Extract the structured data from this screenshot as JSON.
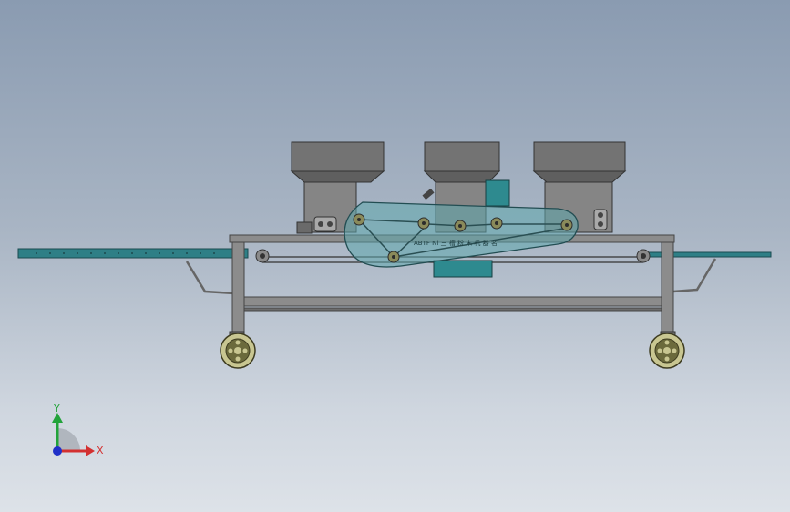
{
  "viewport": {
    "background_top": "#8a9bb1",
    "background_bottom": "#dde2e8"
  },
  "model": {
    "machine_label": "ABTF Ni 三 槽 粉 末 机 器 名",
    "colors": {
      "frame": "#8c8c8c",
      "frame_dark": "#555555",
      "hopper": "#6e6e6e",
      "hopper_light": "#8f8f8f",
      "conveyor": "#2e7f86",
      "guard_fill": "#5fa7ad",
      "motor": "#2e8a8f",
      "wheel_rim": "#6b6a3c",
      "wheel_tread": "#c8c691"
    }
  },
  "triad": {
    "x_label": "X",
    "y_label": "Y",
    "x_color": "#d33030",
    "y_color": "#22a33a",
    "z_color": "#2030c8"
  }
}
